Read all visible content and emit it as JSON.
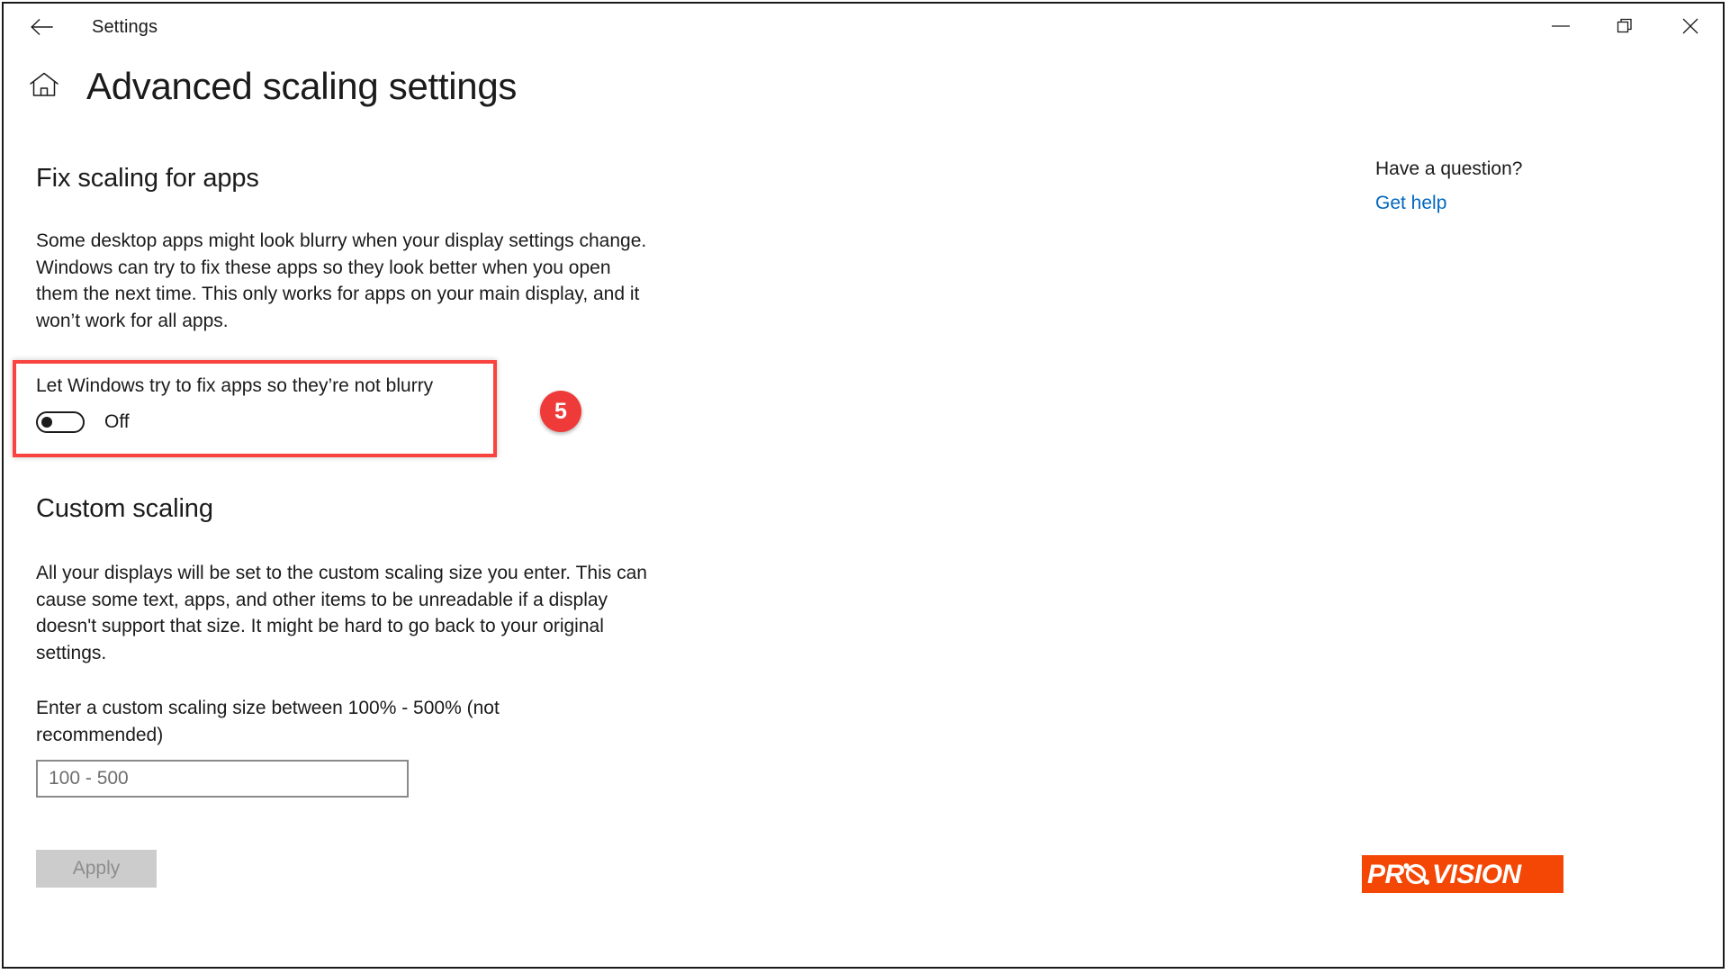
{
  "window": {
    "title": "Settings",
    "back_icon": "arrow-left-icon",
    "controls": [
      {
        "name": "minimize",
        "icon": "minimize-icon"
      },
      {
        "name": "restore",
        "icon": "restore-icon"
      },
      {
        "name": "close",
        "icon": "close-icon"
      }
    ]
  },
  "page": {
    "home_icon": "home-icon",
    "title": "Advanced scaling settings"
  },
  "fix_scaling": {
    "heading": "Fix scaling for apps",
    "description": "Some desktop apps might look blurry when your display settings change. Windows can try to fix these apps so they look better when you open them the next time. This only works for apps on your main display, and it won’t work for all apps.",
    "toggle_label": "Let Windows try to fix apps so they’re not blurry",
    "toggle_state": "Off",
    "toggle_on": false,
    "highlight_color": "#f8433e"
  },
  "step_badge": {
    "number": "5",
    "color": "#ee3b39"
  },
  "custom_scaling": {
    "heading": "Custom scaling",
    "description": "All your displays will be set to the custom scaling size you enter. This can cause some text, apps, and other items to be unreadable if a display doesn't support that size. It might be hard to go back to your original settings.",
    "input_label": "Enter a custom scaling size between 100% - 500% (not recommended)",
    "input_value": "",
    "input_placeholder": "100 - 500",
    "apply_label": "Apply",
    "apply_enabled": false
  },
  "help": {
    "heading": "Have a question?",
    "link_label": "Get help",
    "link_color": "#0067c0"
  },
  "logo": {
    "text": "PROVISION",
    "text_before": "PR",
    "text_after": "VISION",
    "background": "#f44605",
    "foreground": "#ffffff"
  }
}
